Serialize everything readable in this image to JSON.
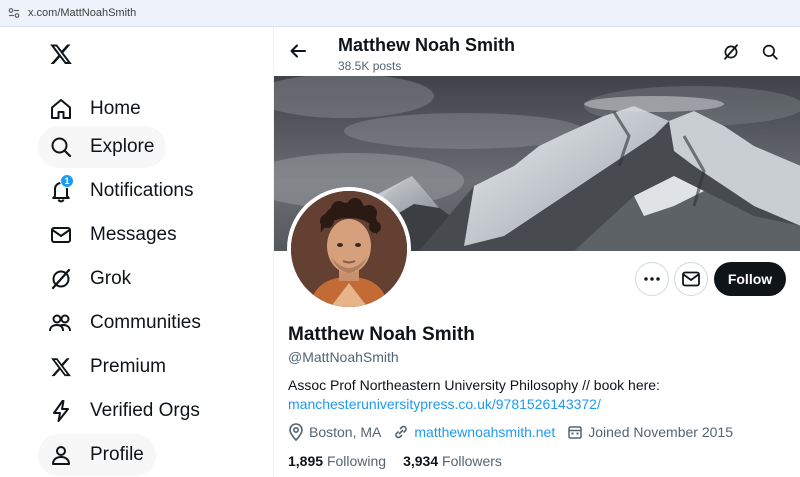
{
  "browser": {
    "url": "x.com/MattNoahSmith"
  },
  "nav": {
    "logo_icon": "x-logo-icon",
    "items": [
      {
        "label": "Home",
        "icon": "home-icon"
      },
      {
        "label": "Explore",
        "icon": "search-icon"
      },
      {
        "label": "Notifications",
        "icon": "bell-icon",
        "badge": "1"
      },
      {
        "label": "Messages",
        "icon": "envelope-icon"
      },
      {
        "label": "Grok",
        "icon": "grok-icon"
      },
      {
        "label": "Communities",
        "icon": "people-icon"
      },
      {
        "label": "Premium",
        "icon": "x-logo-icon"
      },
      {
        "label": "Verified Orgs",
        "icon": "lightning-icon"
      },
      {
        "label": "Profile",
        "icon": "person-icon"
      }
    ]
  },
  "header": {
    "name": "Matthew Noah Smith",
    "posts": "38.5K posts"
  },
  "profile": {
    "name": "Matthew Noah Smith",
    "handle": "@MattNoahSmith",
    "bio_text": "Assoc Prof Northeastern University Philosophy // book here:",
    "bio_link": "manchesteruniversitypress.co.uk/9781526143372/",
    "location": "Boston, MA",
    "website": "matthewnoahsmith.net",
    "joined": "Joined November 2015",
    "following_count": "1,895",
    "following_label": "Following",
    "followers_count": "3,934",
    "followers_label": "Followers"
  },
  "actions": {
    "follow_label": "Follow"
  },
  "colors": {
    "accent": "#1d9bf0",
    "text": "#0f1419",
    "muted": "#536471"
  }
}
